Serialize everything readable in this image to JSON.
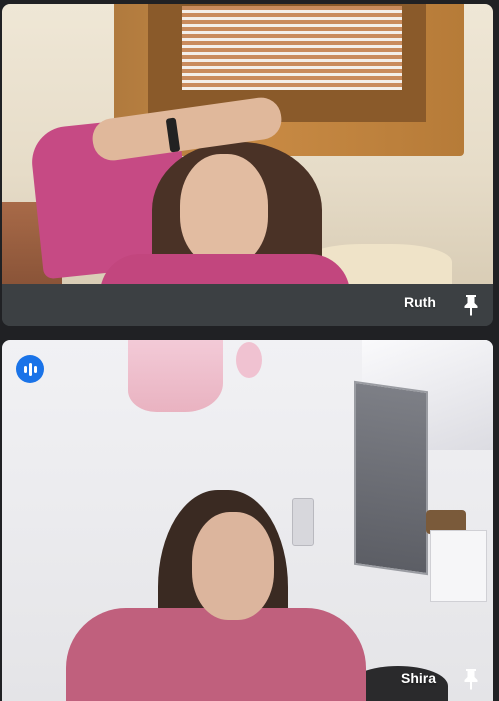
{
  "participants": [
    {
      "name": "Ruth",
      "pinned": true,
      "speaking": false
    },
    {
      "name": "Shira",
      "pinned": true,
      "speaking": true
    }
  ],
  "icons": {
    "pin": "pin-icon",
    "audio": "audio-level-icon"
  },
  "colors": {
    "background": "#202124",
    "tile_footer": "#3c4043",
    "speaking_badge": "#1a73e8",
    "text": "#ffffff"
  }
}
